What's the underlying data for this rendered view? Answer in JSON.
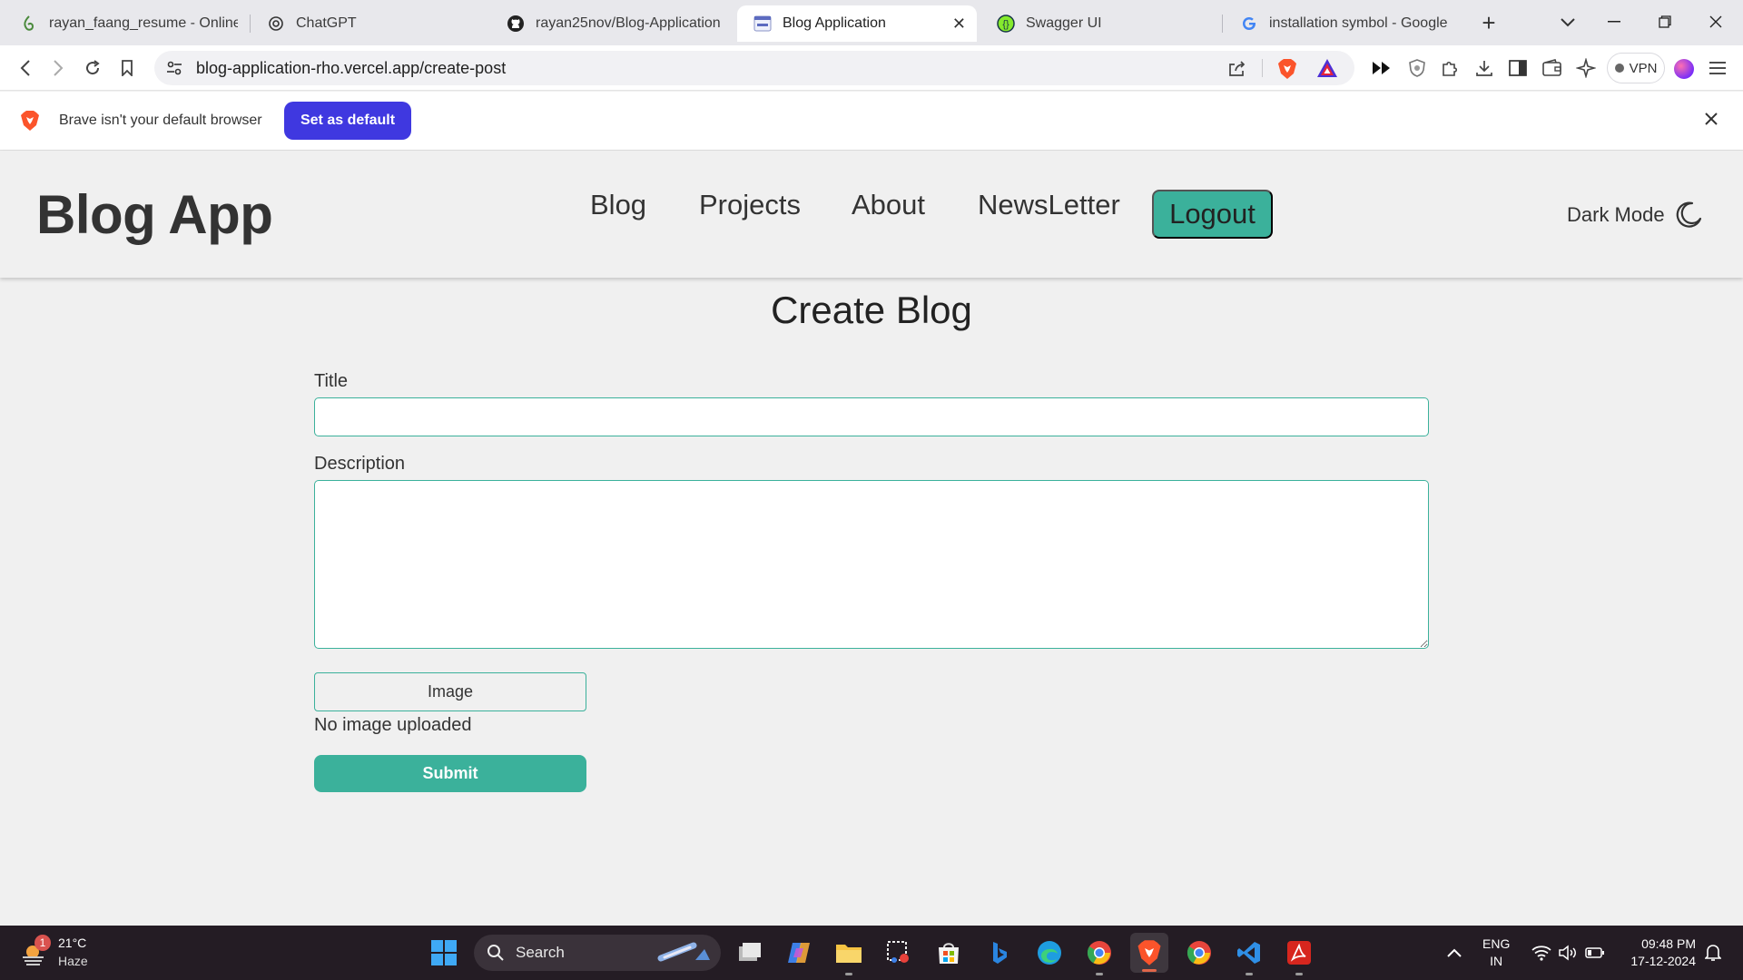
{
  "browser": {
    "tabs": [
      {
        "title": "rayan_faang_resume - Online L",
        "icon": "overleaf-icon",
        "active": false
      },
      {
        "title": "ChatGPT",
        "icon": "chatgpt-icon",
        "active": false
      },
      {
        "title": "rayan25nov/Blog-Application",
        "icon": "github-icon",
        "active": false
      },
      {
        "title": "Blog Application",
        "icon": "blog-favicon",
        "active": true
      },
      {
        "title": "Swagger UI",
        "icon": "swagger-icon",
        "active": false
      },
      {
        "title": "installation symbol - Google Se",
        "icon": "google-icon",
        "active": false
      }
    ],
    "address": "blog-application-rho.vercel.app/create-post",
    "vpn_label": "VPN"
  },
  "infobar": {
    "message": "Brave isn't your default browser",
    "button": "Set as default"
  },
  "app": {
    "brand": "Blog App",
    "nav": [
      "Blog",
      "Projects",
      "About",
      "NewsLetter"
    ],
    "logout": "Logout",
    "dark_mode": "Dark Mode"
  },
  "form": {
    "heading": "Create Blog",
    "title_label": "Title",
    "title_value": "",
    "description_label": "Description",
    "description_value": "",
    "image_button": "Image",
    "image_status": "No image uploaded",
    "submit": "Submit",
    "accent_color": "#3bb19b"
  },
  "taskbar": {
    "weather_temp": "21°C",
    "weather_cond": "Haze",
    "weather_badge": "1",
    "search": "Search",
    "lang_line1": "ENG",
    "lang_line2": "IN",
    "time": "09:48 PM",
    "date": "17-12-2024"
  }
}
